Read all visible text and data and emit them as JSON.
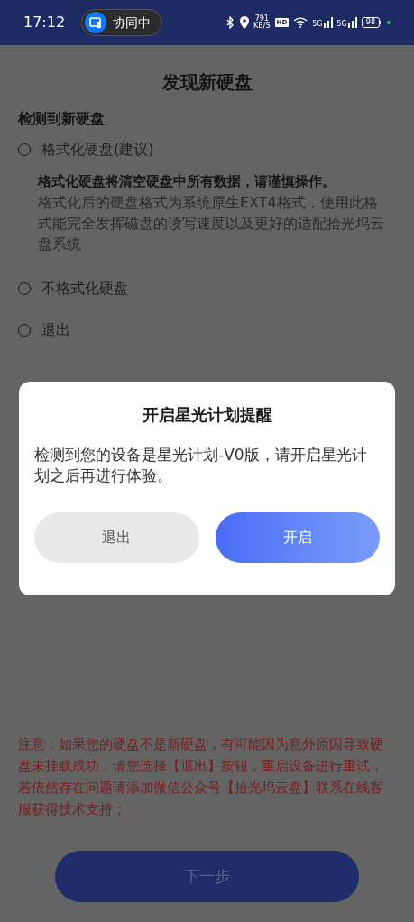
{
  "status_bar": {
    "time": "17:12",
    "collab_label": "协同中",
    "speed_value": "791",
    "speed_unit": "KB/S",
    "hd_label": "HD",
    "signals": [
      {
        "label": "5G"
      },
      {
        "label": "5G"
      }
    ],
    "battery": "98"
  },
  "page": {
    "title": "发现新硬盘",
    "section_label": "检测到新硬盘",
    "options": [
      {
        "label": "格式化硬盘(建议)",
        "selected": false,
        "warning": "格式化硬盘将清空硬盘中所有数据，请谨慎操作。",
        "description": "格式化后的硬盘格式为系统原生EXT4格式，使用此格式能完全发挥磁盘的读写速度以及更好的适配拾光坞云盘系统"
      },
      {
        "label": "不格式化硬盘",
        "selected": false
      },
      {
        "label": "退出",
        "selected": false
      }
    ],
    "notice": "注意：如果您的硬盘不是新硬盘，有可能因为意外原因导致硬盘未挂载成功，请您选择【退出】按钮，重启设备进行重试，若依然存在问题请添加微信公众号【拾光坞云盘】联系在线客服获得技术支持；",
    "next_button": {
      "label": "下一步",
      "disabled": true
    }
  },
  "dialog": {
    "title": "开启星光计划提醒",
    "message": "检测到您的设备是星光计划-V0版，请开启星光计划之后再进行体验。",
    "buttons": [
      {
        "label": "退出",
        "kind": "secondary"
      },
      {
        "label": "开启",
        "kind": "primary"
      }
    ]
  }
}
